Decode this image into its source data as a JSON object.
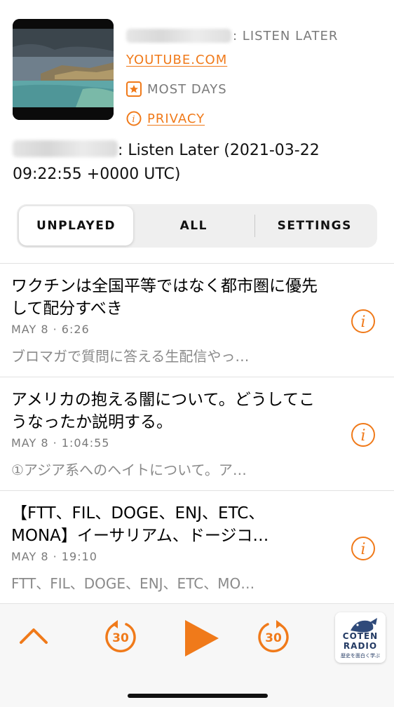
{
  "header": {
    "listen_later_suffix": ": LISTEN LATER",
    "source_link": "YOUTUBE.COM",
    "frequency": "MOST DAYS",
    "privacy_link": "PRIVACY",
    "description_suffix": ": Listen Later (2021-03-22 09:22:55 +0000 UTC)"
  },
  "tabs": [
    {
      "label": "UNPLAYED"
    },
    {
      "label": "ALL"
    },
    {
      "label": "SETTINGS"
    }
  ],
  "episodes": [
    {
      "title": "ワクチンは全国平等ではなく都市圏に優先して配分すべき",
      "date": "MAY 8 · 6:26",
      "snippet": "ブロマガで質問に答える生配信やっ…"
    },
    {
      "title": "アメリカの抱える闇について。どうしてこうなったか説明する。",
      "date": "MAY 8 · 1:04:55",
      "snippet": "①アジア系へのヘイトについて。ア…"
    },
    {
      "title": "【FTT、FIL、DOGE、ENJ、ETC、MONA】イーサリアム、ドージコ…",
      "date": "MAY 8 · 19:10",
      "snippet": "FTT、FIL、DOGE、ENJ、ETC、MO…"
    }
  ],
  "player": {
    "skip_back_seconds": "30",
    "skip_forward_seconds": "30",
    "now_playing_logo_line1": "COTEN",
    "now_playing_logo_line2": "RADIO",
    "now_playing_logo_tagline": "歴史を面白く学ぶ"
  },
  "colors": {
    "accent": "#f07a1a",
    "muted_text": "#7a7a7a"
  }
}
